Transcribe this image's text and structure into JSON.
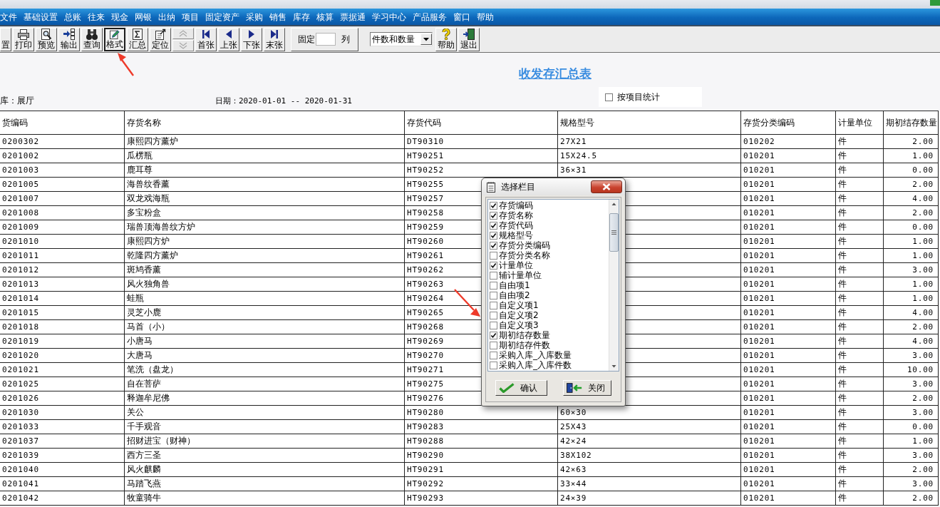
{
  "menu_bar": {
    "items": [
      "文件",
      "基础设置",
      "总账",
      "往来",
      "现金",
      "网银",
      "出纳",
      "项目",
      "固定资产",
      "采购",
      "销售",
      "库存",
      "核算",
      "票据通",
      "学习中心",
      "产品服务",
      "窗口",
      "帮助"
    ]
  },
  "toolbar": {
    "items": [
      {
        "kind": "button",
        "label": "置",
        "selected": false
      },
      {
        "kind": "button",
        "label": "打印",
        "selected": false
      },
      {
        "kind": "button",
        "label": "预览",
        "selected": false
      },
      {
        "kind": "button",
        "label": "输出",
        "selected": false
      },
      {
        "kind": "button",
        "label": "查询",
        "selected": false
      },
      {
        "kind": "button",
        "label": "格式",
        "selected": true
      },
      {
        "kind": "button",
        "label": "汇总",
        "selected": false
      },
      {
        "kind": "button",
        "label": "定位",
        "selected": false
      },
      {
        "kind": "stepper",
        "disabled": true
      },
      {
        "kind": "button",
        "label": "首张",
        "selected": false
      },
      {
        "kind": "button",
        "label": "上张",
        "selected": false
      },
      {
        "kind": "button",
        "label": "下张",
        "selected": false
      },
      {
        "kind": "button",
        "label": "末张",
        "selected": false
      },
      {
        "kind": "fixed",
        "label": "固定",
        "unit": "列"
      },
      {
        "kind": "dropdown",
        "value": "件数和数量"
      },
      {
        "kind": "button",
        "label": "帮助",
        "selected": false
      },
      {
        "kind": "button",
        "label": "退出",
        "selected": false
      }
    ]
  },
  "report": {
    "title": "收发存汇总表",
    "warehouse": "库：展厅",
    "date_range": "日期：2020-01-01 -- 2020-01-31",
    "by_project": {
      "label": "按项目统计",
      "checked": false
    }
  },
  "table": {
    "columns": [
      "货编码",
      "存货名称",
      "存货代码",
      "规格型号",
      "存货分类编码",
      "计量单位",
      "期初结存数量"
    ],
    "rows": [
      {
        "code": "0200302",
        "name": "康熙四方薰炉",
        "item_code": "DT90310",
        "spec": "27X21",
        "category": "010202",
        "unit": "件",
        "opening_qty": "2.00"
      },
      {
        "code": "0201002",
        "name": "瓜楞瓶",
        "item_code": "HT90251",
        "spec": "15X24.5",
        "category": "010201",
        "unit": "件",
        "opening_qty": "1.00"
      },
      {
        "code": "0201003",
        "name": "鹿耳尊",
        "item_code": "HT90252",
        "spec": "36×31",
        "category": "010201",
        "unit": "件",
        "opening_qty": "0.00"
      },
      {
        "code": "0201005",
        "name": "海兽纹香薰",
        "item_code": "HT90255",
        "category": "010201",
        "unit": "件",
        "opening_qty": "2.00"
      },
      {
        "code": "0201007",
        "name": "双龙戏海瓶",
        "item_code": "HT90257",
        "category": "010201",
        "unit": "件",
        "opening_qty": "4.00"
      },
      {
        "code": "0201008",
        "name": "多宝粉盒",
        "item_code": "HT90258",
        "category": "010201",
        "unit": "件",
        "opening_qty": "2.00"
      },
      {
        "code": "0201009",
        "name": "瑞兽顶海兽纹方炉",
        "item_code": "HT90259",
        "category": "010201",
        "unit": "件",
        "opening_qty": "0.00"
      },
      {
        "code": "0201010",
        "name": "康熙四方炉",
        "item_code": "HT90260",
        "category": "010201",
        "unit": "件",
        "opening_qty": "1.00"
      },
      {
        "code": "0201011",
        "name": "乾隆四方薰炉",
        "item_code": "HT90261",
        "category": "010201",
        "unit": "件",
        "opening_qty": "1.00"
      },
      {
        "code": "0201012",
        "name": "斑鸠香薰",
        "item_code": "HT90262",
        "category": "010201",
        "unit": "件",
        "opening_qty": "3.00"
      },
      {
        "code": "0201013",
        "name": "风火独角兽",
        "item_code": "HT90263",
        "category": "010201",
        "unit": "件",
        "opening_qty": "1.00"
      },
      {
        "code": "0201014",
        "name": "蛙瓶",
        "item_code": "HT90264",
        "category": "010201",
        "unit": "件",
        "opening_qty": "1.00"
      },
      {
        "code": "0201015",
        "name": "灵芝小鹿",
        "item_code": "HT90265",
        "category": "010201",
        "unit": "件",
        "opening_qty": "4.00"
      },
      {
        "code": "0201018",
        "name": "马首（小）",
        "item_code": "HT90268",
        "category": "010201",
        "unit": "件",
        "opening_qty": "2.00"
      },
      {
        "code": "0201019",
        "name": "小唐马",
        "item_code": "HT90269",
        "category": "010201",
        "unit": "件",
        "opening_qty": "4.00"
      },
      {
        "code": "0201020",
        "name": "大唐马",
        "item_code": "HT90270",
        "category": "010201",
        "unit": "件",
        "opening_qty": "3.00"
      },
      {
        "code": "0201021",
        "name": "笔洗（盘龙）",
        "item_code": "HT90271",
        "category": "010201",
        "unit": "件",
        "opening_qty": "10.00"
      },
      {
        "code": "0201025",
        "name": "自在菩萨",
        "item_code": "HT90275",
        "category": "010201",
        "unit": "件",
        "opening_qty": "3.00"
      },
      {
        "code": "0201026",
        "name": "释迦牟尼佛",
        "item_code": "HT90276",
        "category": "010201",
        "unit": "件",
        "opening_qty": "2.00"
      },
      {
        "code": "0201030",
        "name": "关公",
        "item_code": "HT90280",
        "spec": "60×30",
        "category": "010201",
        "unit": "件",
        "opening_qty": "3.00"
      },
      {
        "code": "0201033",
        "name": "千手观音",
        "item_code": "HT90283",
        "spec": "25X43",
        "category": "010201",
        "unit": "件",
        "opening_qty": "0.00"
      },
      {
        "code": "0201037",
        "name": "招财进宝（财神）",
        "item_code": "HT90288",
        "spec": "42×24",
        "category": "010201",
        "unit": "件",
        "opening_qty": "1.00"
      },
      {
        "code": "0201039",
        "name": "西方三圣",
        "item_code": "HT90290",
        "spec": "38X102",
        "category": "010201",
        "unit": "件",
        "opening_qty": "3.00"
      },
      {
        "code": "0201040",
        "name": "风火麒麟",
        "item_code": "HT90291",
        "spec": "42×63",
        "category": "010201",
        "unit": "件",
        "opening_qty": "2.00"
      },
      {
        "code": "0201041",
        "name": "马踏飞燕",
        "item_code": "HT90292",
        "spec": "33×44",
        "category": "010201",
        "unit": "件",
        "opening_qty": "3.00"
      },
      {
        "code": "0201042",
        "name": "牧童骑牛",
        "item_code": "HT90293",
        "spec": "24×39",
        "category": "010201",
        "unit": "件",
        "opening_qty": "2.00"
      }
    ]
  },
  "dialog": {
    "title": "选择栏目",
    "items": [
      {
        "label": "存货编码",
        "checked": true
      },
      {
        "label": "存货名称",
        "checked": true
      },
      {
        "label": "存货代码",
        "checked": true
      },
      {
        "label": "规格型号",
        "checked": true
      },
      {
        "label": "存货分类编码",
        "checked": true
      },
      {
        "label": "存货分类名称",
        "checked": false
      },
      {
        "label": "计量单位",
        "checked": true
      },
      {
        "label": "辅计量单位",
        "checked": false
      },
      {
        "label": "自由项1",
        "checked": false
      },
      {
        "label": "自由项2",
        "checked": false
      },
      {
        "label": "自定义项1",
        "checked": false
      },
      {
        "label": "自定义项2",
        "checked": false
      },
      {
        "label": "自定义项3",
        "checked": false
      },
      {
        "label": "期初结存数量",
        "checked": true
      },
      {
        "label": "期初结存件数",
        "checked": false
      },
      {
        "label": "采购入库_入库数量",
        "checked": false
      },
      {
        "label": "采购入库_入库件数",
        "checked": false
      }
    ],
    "buttons": [
      "确认",
      "关闭"
    ]
  }
}
